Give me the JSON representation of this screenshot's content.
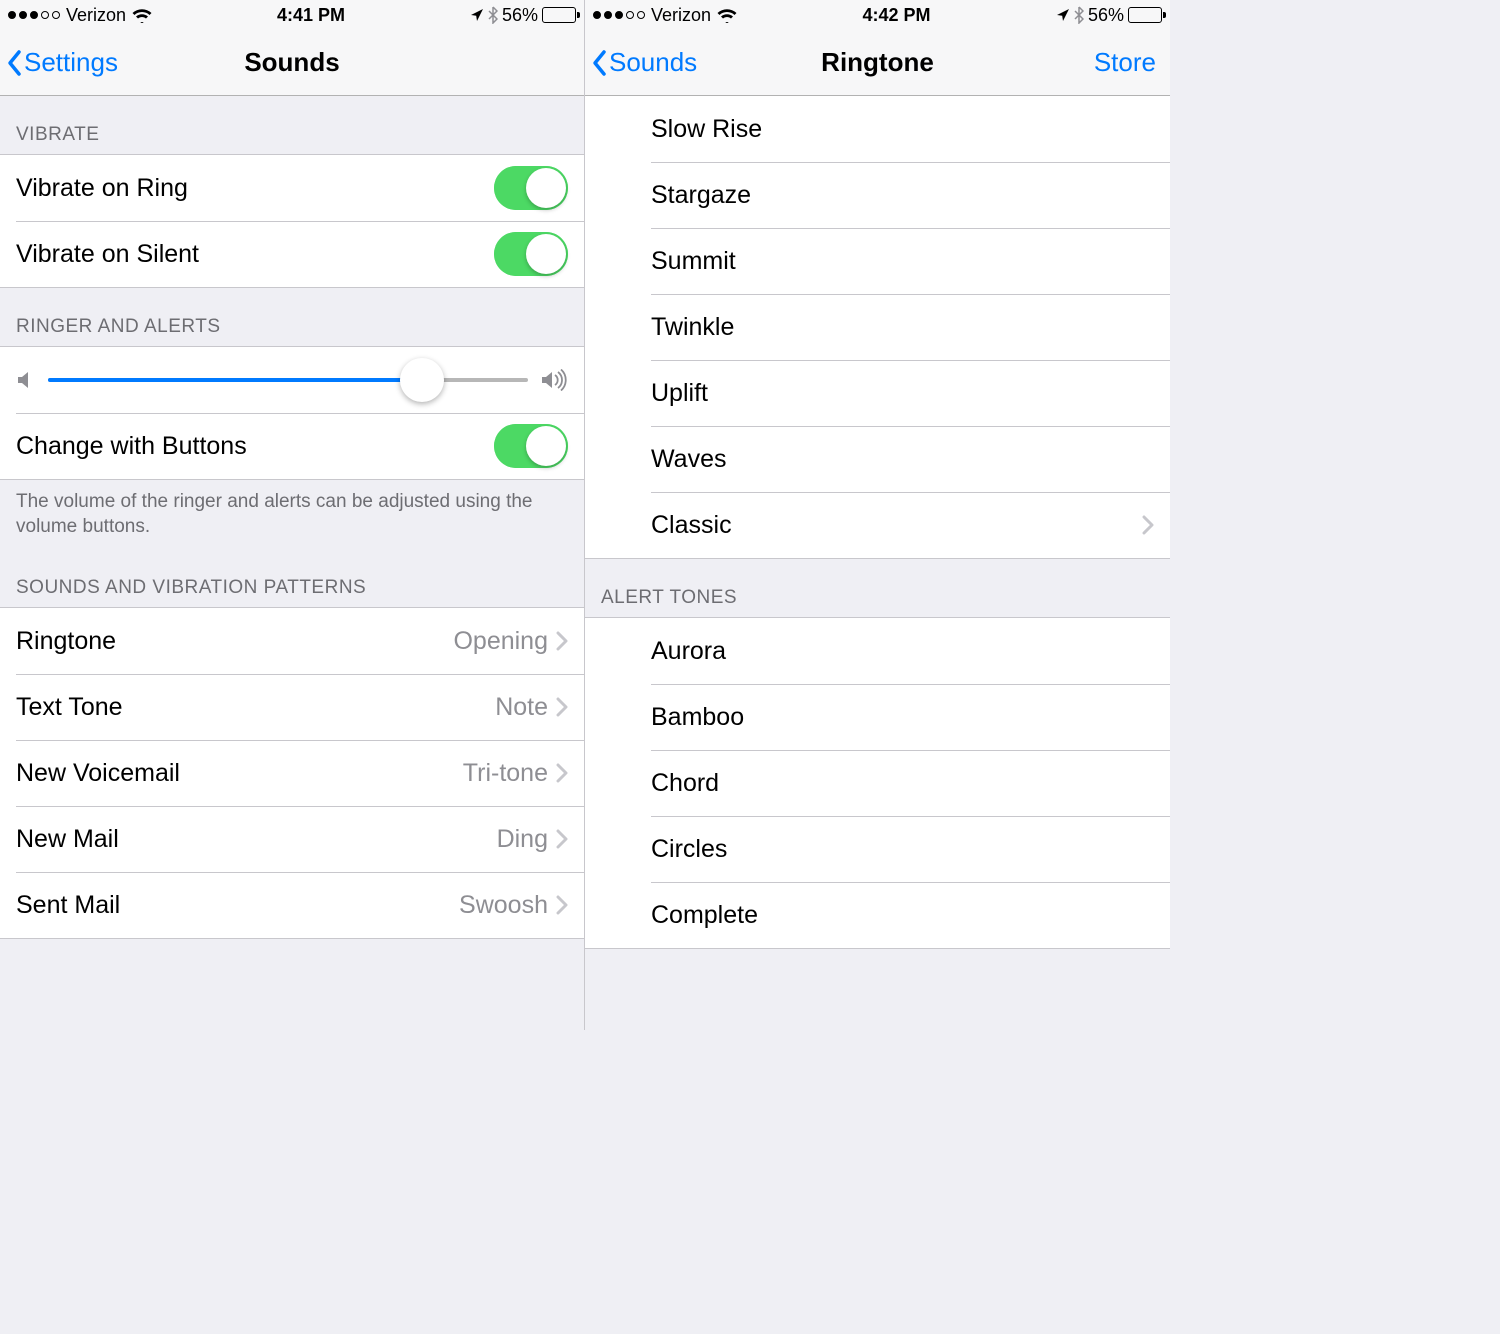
{
  "left": {
    "status": {
      "carrier": "Verizon",
      "time": "4:41 PM",
      "battery_percent": "56%",
      "battery_level": 56
    },
    "nav": {
      "back": "Settings",
      "title": "Sounds"
    },
    "sections": {
      "vibrate": {
        "header": "VIBRATE",
        "items": [
          {
            "label": "Vibrate on Ring",
            "on": true
          },
          {
            "label": "Vibrate on Silent",
            "on": true
          }
        ]
      },
      "ringer": {
        "header": "RINGER AND ALERTS",
        "slider_value": 78,
        "change_label": "Change with Buttons",
        "change_on": true,
        "footer": "The volume of the ringer and alerts can be adjusted using the volume buttons."
      },
      "patterns": {
        "header": "SOUNDS AND VIBRATION PATTERNS",
        "items": [
          {
            "label": "Ringtone",
            "value": "Opening"
          },
          {
            "label": "Text Tone",
            "value": "Note"
          },
          {
            "label": "New Voicemail",
            "value": "Tri-tone"
          },
          {
            "label": "New Mail",
            "value": "Ding"
          },
          {
            "label": "Sent Mail",
            "value": "Swoosh"
          }
        ]
      }
    }
  },
  "right": {
    "status": {
      "carrier": "Verizon",
      "time": "4:42 PM",
      "battery_percent": "56%",
      "battery_level": 56
    },
    "nav": {
      "back": "Sounds",
      "title": "Ringtone",
      "right": "Store"
    },
    "ringtones": {
      "items": [
        {
          "label": "Slow Rise"
        },
        {
          "label": "Stargaze"
        },
        {
          "label": "Summit"
        },
        {
          "label": "Twinkle"
        },
        {
          "label": "Uplift"
        },
        {
          "label": "Waves"
        },
        {
          "label": "Classic",
          "disclosure": true
        }
      ]
    },
    "alert_tones": {
      "header": "ALERT TONES",
      "items": [
        {
          "label": "Aurora"
        },
        {
          "label": "Bamboo"
        },
        {
          "label": "Chord"
        },
        {
          "label": "Circles"
        },
        {
          "label": "Complete"
        }
      ]
    }
  }
}
